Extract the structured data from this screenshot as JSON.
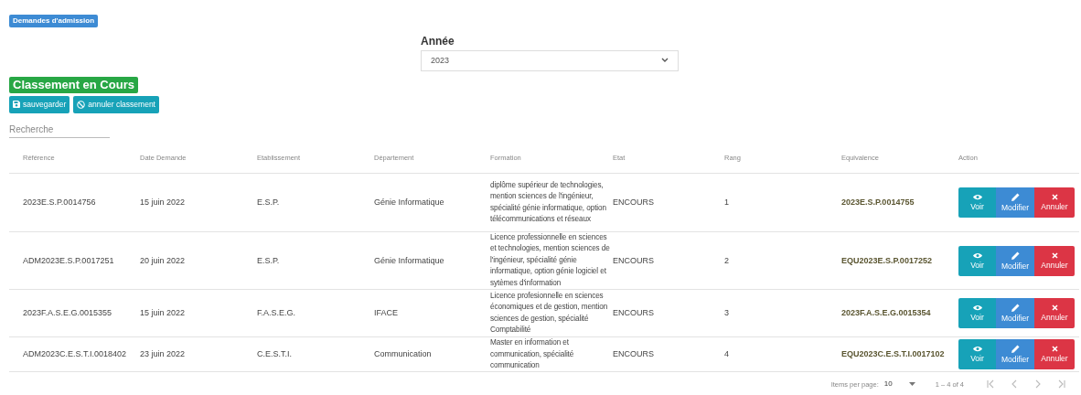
{
  "header_badge": "Demandes d'admission",
  "year": {
    "label": "Année",
    "value": "2023"
  },
  "status_badge": "Classement en Cours",
  "toolbar": [
    {
      "kind": "save",
      "label": "sauvegarder"
    },
    {
      "kind": "cancel",
      "label": "annuler classement"
    }
  ],
  "search": {
    "placeholder": "Recherche"
  },
  "table": {
    "columns": [
      "Référence",
      "Date Demande",
      "Etablissement",
      "Département",
      "Formation",
      "Etat",
      "Rang",
      "Equivalence",
      "Action"
    ],
    "rows": [
      {
        "cells": [
          "2023E.S.P.0014756",
          "15 juin 2022",
          "E.S.P.",
          "Génie Informatique",
          "diplôme supérieur de technologies, mention sciences de l'ingénieur, spécialité génie informatique, option télécommunications et réseaux",
          "ENCOURS",
          "1",
          "2023E.S.P.0014755"
        ],
        "actions": [
          {
            "kind": "view",
            "label": "Voir"
          },
          {
            "kind": "edit",
            "label": "Modifier"
          },
          {
            "kind": "delete",
            "label": "Annuler"
          }
        ]
      },
      {
        "cells": [
          "ADM2023E.S.P.0017251",
          "20 juin 2022",
          "E.S.P.",
          "Génie Informatique",
          "Licence professionnelle en sciences et technologies, mention sciences de l'ingénieur, spécialité génie informatique, option génie logiciel et sytèmes d'information",
          "ENCOURS",
          "2",
          "EQU2023E.S.P.0017252"
        ],
        "actions": [
          {
            "kind": "view",
            "label": "Voir"
          },
          {
            "kind": "edit",
            "label": "Modifier"
          },
          {
            "kind": "delete",
            "label": "Annuler"
          }
        ]
      },
      {
        "cells": [
          "2023F.A.S.E.G.0015355",
          "15 juin 2022",
          "F.A.S.E.G.",
          "IFACE",
          "Licence profesionnelle en sciences économiques et de gestion, mention sciences de gestion, spécialité Comptabilité",
          "ENCOURS",
          "3",
          "2023F.A.S.E.G.0015354"
        ],
        "actions": [
          {
            "kind": "view",
            "label": "Voir"
          },
          {
            "kind": "edit",
            "label": "Modifier"
          },
          {
            "kind": "delete",
            "label": "Annuler"
          }
        ]
      },
      {
        "cells": [
          "ADM2023C.E.S.T.I.0018402",
          "23 juin 2022",
          "C.E.S.T.I.",
          "Communication",
          "Master en information et communication, spécialité communication",
          "ENCOURS",
          "4",
          "EQU2023C.E.S.T.I.0017102"
        ],
        "actions": [
          {
            "kind": "view",
            "label": "Voir"
          },
          {
            "kind": "edit",
            "label": "Modifier"
          },
          {
            "kind": "delete",
            "label": "Annuler"
          }
        ]
      }
    ]
  },
  "paginator": {
    "items_per_page_label": "Items per page:",
    "page_size": "10",
    "range": "1 – 4 of 4",
    "nav": [
      {
        "kind": "first",
        "disabled": true
      },
      {
        "kind": "prev",
        "disabled": true
      },
      {
        "kind": "next",
        "disabled": true
      },
      {
        "kind": "last",
        "disabled": true
      }
    ]
  }
}
